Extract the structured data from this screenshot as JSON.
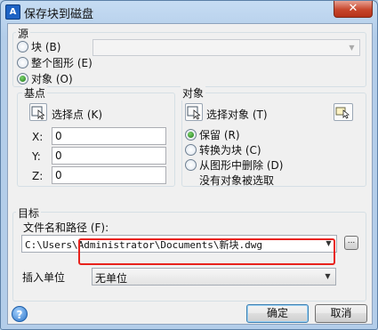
{
  "window": {
    "title": "保存块到磁盘",
    "close_glyph": "✕",
    "app_icon": "autocad-icon"
  },
  "source": {
    "title": "源",
    "radios": [
      {
        "label": "块 (B)",
        "selected": false
      },
      {
        "label": "整个图形 (E)",
        "selected": false
      },
      {
        "label": "对象 (O)",
        "selected": true
      }
    ],
    "block_combo": {
      "value": "",
      "disabled": true
    }
  },
  "basepoint": {
    "title": "基点",
    "pick_label": "选择点 (K)",
    "fields": [
      {
        "label": "X:",
        "value": "0"
      },
      {
        "label": "Y:",
        "value": "0"
      },
      {
        "label": "Z:",
        "value": "0"
      }
    ]
  },
  "objects": {
    "title": "对象",
    "select_label": "选择对象 (T)",
    "radios": [
      {
        "label": "保留 (R)",
        "selected": true
      },
      {
        "label": "转换为块 (C)",
        "selected": false
      },
      {
        "label": "从图形中删除 (D)",
        "selected": false
      }
    ],
    "status": "没有对象被选取"
  },
  "target": {
    "title": "目标",
    "path_label": "文件名和路径 (F):",
    "path_value": "C:\\Users\\Administrator\\Documents\\新块.dwg",
    "browse_label": "...",
    "units_label": "插入单位",
    "units_value": "无单位"
  },
  "buttons": {
    "ok": "确定",
    "cancel": "取消",
    "help_glyph": "?"
  },
  "colors": {
    "highlight": "#e8221c",
    "radio_dot": "#1f7a1a"
  }
}
